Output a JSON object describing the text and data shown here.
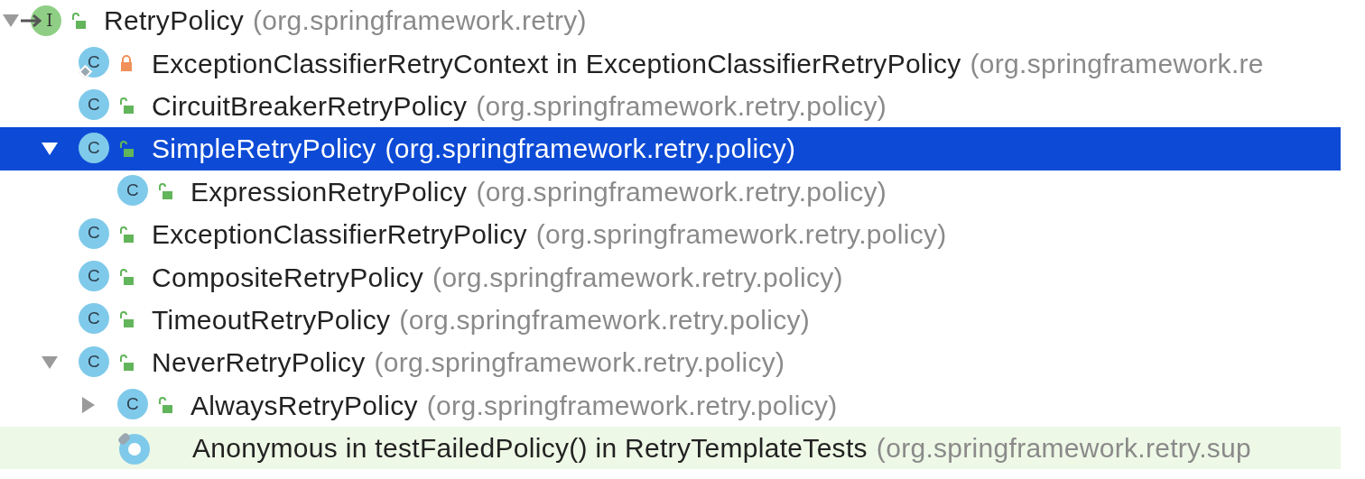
{
  "tree": {
    "name": "RetryPolicy",
    "package": "(org.springframework.retry)",
    "kind": "interface",
    "badge": "I",
    "lock": {
      "kind": "open"
    },
    "arrow": true,
    "expanded": true,
    "selected": false,
    "highlighted": false,
    "children": [
      {
        "name": "ExceptionClassifierRetryContext in ExceptionClassifierRetryPolicy",
        "package": "(org.springframework.re",
        "kind": "inner-class",
        "badge": "C",
        "lock": {
          "kind": "closed"
        },
        "arrow": false,
        "expanded": false,
        "selected": false,
        "highlighted": false
      },
      {
        "name": "CircuitBreakerRetryPolicy",
        "package": "(org.springframework.retry.policy)",
        "kind": "class",
        "badge": "C",
        "lock": {
          "kind": "open"
        },
        "arrow": false,
        "expanded": false,
        "selected": false,
        "highlighted": false
      },
      {
        "name": "SimpleRetryPolicy",
        "package": "(org.springframework.retry.policy)",
        "kind": "class",
        "badge": "C",
        "lock": {
          "kind": "open"
        },
        "arrow": true,
        "expanded": true,
        "selected": true,
        "highlighted": false,
        "children": [
          {
            "name": "ExpressionRetryPolicy",
            "package": "(org.springframework.retry.policy)",
            "kind": "class",
            "badge": "C",
            "lock": {
              "kind": "open"
            },
            "arrow": false,
            "expanded": false,
            "selected": false,
            "highlighted": false
          }
        ]
      },
      {
        "name": "ExceptionClassifierRetryPolicy",
        "package": "(org.springframework.retry.policy)",
        "kind": "class",
        "badge": "C",
        "lock": {
          "kind": "open"
        },
        "arrow": false,
        "expanded": false,
        "selected": false,
        "highlighted": false
      },
      {
        "name": "CompositeRetryPolicy",
        "package": "(org.springframework.retry.policy)",
        "kind": "class",
        "badge": "C",
        "lock": {
          "kind": "open"
        },
        "arrow": false,
        "expanded": false,
        "selected": false,
        "highlighted": false
      },
      {
        "name": "TimeoutRetryPolicy",
        "package": "(org.springframework.retry.policy)",
        "kind": "class",
        "badge": "C",
        "lock": {
          "kind": "open"
        },
        "arrow": false,
        "expanded": false,
        "selected": false,
        "highlighted": false
      },
      {
        "name": "NeverRetryPolicy",
        "package": "(org.springframework.retry.policy)",
        "kind": "class",
        "badge": "C",
        "lock": {
          "kind": "open"
        },
        "arrow": true,
        "expanded": true,
        "selected": false,
        "highlighted": false,
        "children": [
          {
            "name": "AlwaysRetryPolicy",
            "package": "(org.springframework.retry.policy)",
            "kind": "class",
            "badge": "C",
            "lock": {
              "kind": "open"
            },
            "arrow": true,
            "expanded": false,
            "selected": false,
            "highlighted": false
          },
          {
            "name": "Anonymous in testFailedPolicy() in RetryTemplateTests",
            "package": "(org.springframework.retry.sup",
            "kind": "anonymous",
            "arrow": false,
            "expanded": false,
            "selected": false,
            "highlighted": true
          }
        ]
      }
    ]
  }
}
